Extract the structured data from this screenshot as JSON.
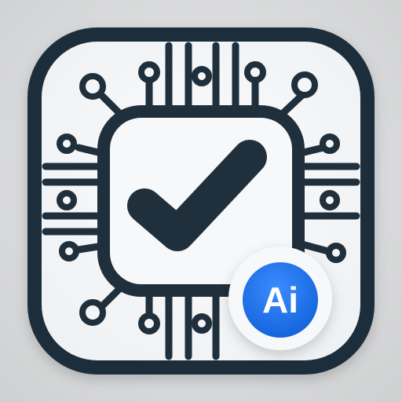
{
  "app_icon": {
    "badge": {
      "text": "Ai"
    },
    "icons": {
      "app": "ai-chip-check-app-icon",
      "center": "checkmark-icon",
      "chip": "circuit-chip-icon",
      "badge": "ai-badge-icon"
    },
    "colors": {
      "background": "#d9dadb",
      "tile": "#f4f5f6",
      "stroke": "#1f2f3b",
      "badge_blue": "#1a6fe8",
      "badge_ring": "#f7f8fa",
      "badge_text": "#ffffff"
    }
  }
}
